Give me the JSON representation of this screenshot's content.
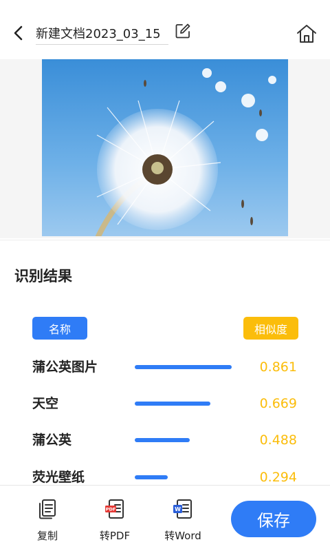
{
  "header": {
    "title": "新建文档2023_03_15"
  },
  "result": {
    "heading": "识别结果",
    "name_label": "名称",
    "similarity_label": "相似度",
    "items": [
      {
        "label": "蒲公英图片",
        "score_text": "0.861",
        "score": 0.861
      },
      {
        "label": "天空",
        "score_text": "0.669",
        "score": 0.669
      },
      {
        "label": "蒲公英",
        "score_text": "0.488",
        "score": 0.488
      },
      {
        "label": "荧光壁纸",
        "score_text": "0.294",
        "score": 0.294
      }
    ]
  },
  "toolbar": {
    "copy_label": "复制",
    "to_pdf_label": "转PDF",
    "to_word_label": "转Word",
    "save_label": "保存"
  },
  "icons": {
    "back": "chevron-left-icon",
    "edit": "edit-icon",
    "home": "home-icon",
    "copy": "copy-document-icon",
    "pdf": "pdf-file-icon",
    "word": "word-file-icon"
  },
  "colors": {
    "accent_blue": "#2f7cf6",
    "accent_yellow": "#fbbd0b"
  }
}
